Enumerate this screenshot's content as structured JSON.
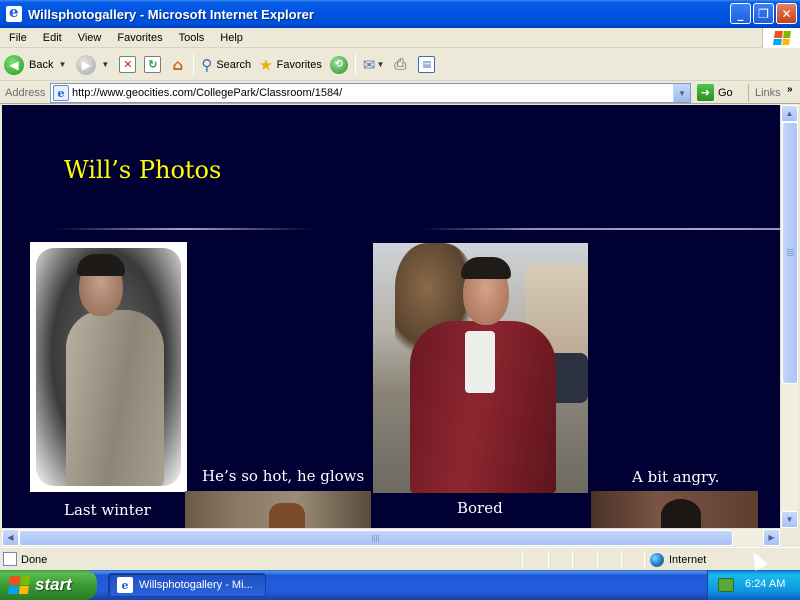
{
  "window": {
    "title": "Willsphotogallery - Microsoft Internet Explorer",
    "controls": {
      "minimize": "_",
      "maximize": "❐",
      "close": "✕"
    }
  },
  "menubar": {
    "items": [
      {
        "label": "File"
      },
      {
        "label": "Edit"
      },
      {
        "label": "View"
      },
      {
        "label": "Favorites"
      },
      {
        "label": "Tools"
      },
      {
        "label": "Help"
      }
    ]
  },
  "toolbar": {
    "back_label": "Back",
    "search_label": "Search",
    "favorites_label": "Favorites",
    "icons": [
      "back-arrow-icon",
      "forward-arrow-icon",
      "stop-icon",
      "refresh-icon",
      "home-icon",
      "search-icon",
      "favorites-star-icon",
      "history-icon",
      "mail-icon",
      "print-icon",
      "edit-icon"
    ]
  },
  "addressbar": {
    "label": "Address",
    "url": "http://www.geocities.com/CollegePark/Classroom/1584/",
    "go_label": "Go",
    "links_label": "Links"
  },
  "page": {
    "background": "#000033",
    "title_color": "#ffff00",
    "title": "Will’s Photos",
    "photos": [
      {
        "caption": "Last winter"
      },
      {
        "caption": "He’s so hot, he glows"
      },
      {
        "caption": "Bored"
      },
      {
        "caption": "A bit angry."
      }
    ]
  },
  "statusbar": {
    "status_text": "Done",
    "zone_text": "Internet"
  },
  "taskbar": {
    "start_label": "start",
    "tasks": [
      {
        "label": "Willsphotogallery - Mi..."
      }
    ],
    "clock": "6:24 AM"
  }
}
